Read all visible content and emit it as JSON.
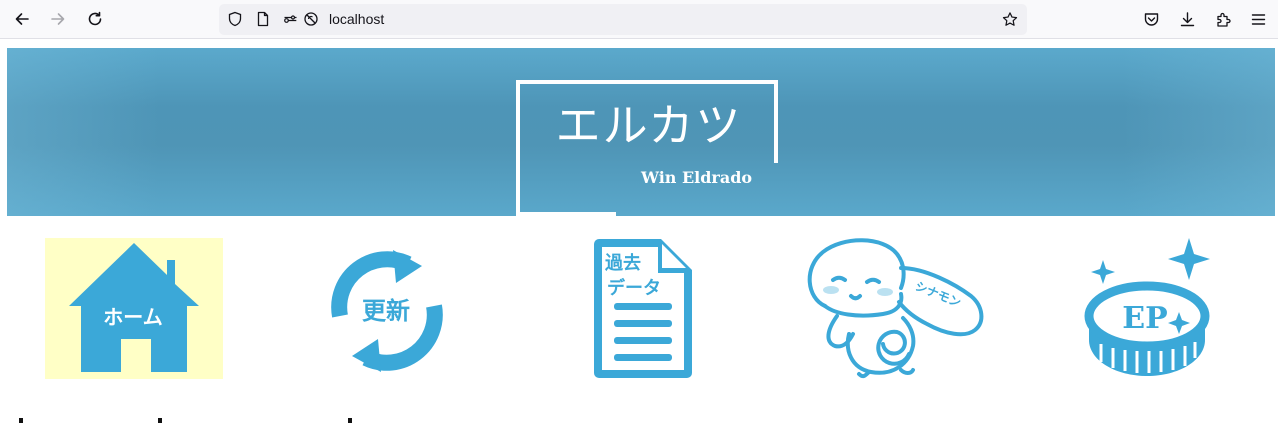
{
  "browser": {
    "url": "localhost"
  },
  "banner": {
    "title": "エルカツ",
    "subtitle": "Win Eldrado",
    "color": "#5aa6c8"
  },
  "nav": {
    "accent": "#3ba8d8",
    "home_bg": "#ffffc6",
    "items": [
      {
        "label": "ホーム"
      },
      {
        "label": "更新"
      },
      {
        "label_line1": "過去",
        "label_line2": "データ"
      },
      {
        "label": "シナモン"
      },
      {
        "label": "EP"
      }
    ]
  }
}
